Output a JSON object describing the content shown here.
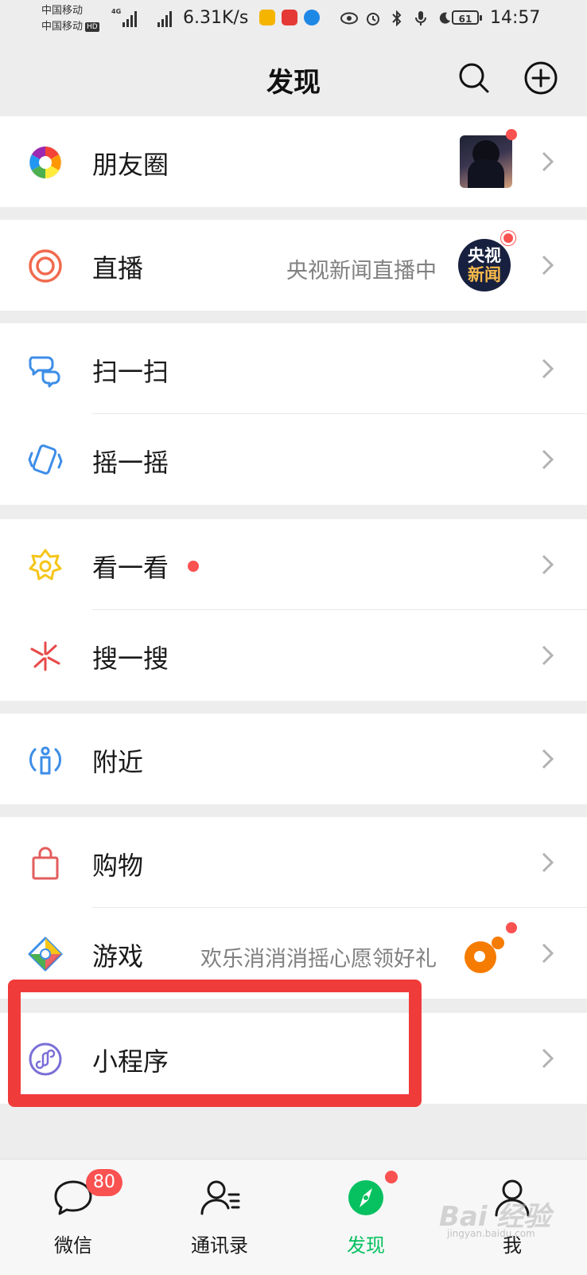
{
  "status_bar": {
    "carrier_1": "中国移动",
    "carrier_2": "中国移动",
    "hd_tag": "HD",
    "net_tag": "4G",
    "net_speed": "6.31K/s",
    "battery": "61",
    "time": "14:57"
  },
  "header": {
    "title": "发现"
  },
  "groups": [
    {
      "rows": [
        {
          "label": "朋友圈",
          "icon": "moments-aperture-icon"
        }
      ]
    },
    {
      "rows": [
        {
          "label": "直播",
          "subtext": "央视新闻直播中",
          "icon": "live-icon",
          "avatar_text_1": "央视",
          "avatar_text_2": "新闻"
        }
      ]
    },
    {
      "rows": [
        {
          "label": "扫一扫",
          "icon": "scan-icon"
        },
        {
          "label": "摇一摇",
          "icon": "shake-icon"
        }
      ]
    },
    {
      "rows": [
        {
          "label": "看一看",
          "icon": "top-stories-icon"
        },
        {
          "label": "搜一搜",
          "icon": "search-sparkle-icon"
        }
      ]
    },
    {
      "rows": [
        {
          "label": "附近",
          "icon": "nearby-icon"
        }
      ]
    },
    {
      "rows": [
        {
          "label": "购物",
          "icon": "shopping-bag-icon"
        },
        {
          "label": "游戏",
          "subtext": "欢乐消消消摇心愿领好礼",
          "icon": "games-icon"
        }
      ]
    },
    {
      "rows": [
        {
          "label": "小程序",
          "icon": "mini-programs-icon"
        }
      ]
    }
  ],
  "tabbar": {
    "tabs": [
      {
        "label": "微信",
        "badge": "80",
        "icon": "chat-bubble-icon"
      },
      {
        "label": "通讯录",
        "icon": "contacts-icon"
      },
      {
        "label": "发现",
        "icon": "discover-compass-icon",
        "active": true
      },
      {
        "label": "我",
        "icon": "me-person-icon"
      }
    ]
  },
  "watermark": {
    "text": "Bai 经验",
    "sub": "jingyan.baidu.com"
  },
  "colors": {
    "accent_green": "#07c160",
    "badge_red": "#fa5151",
    "highlight_red": "#f03b3b",
    "background": "#ededed"
  }
}
